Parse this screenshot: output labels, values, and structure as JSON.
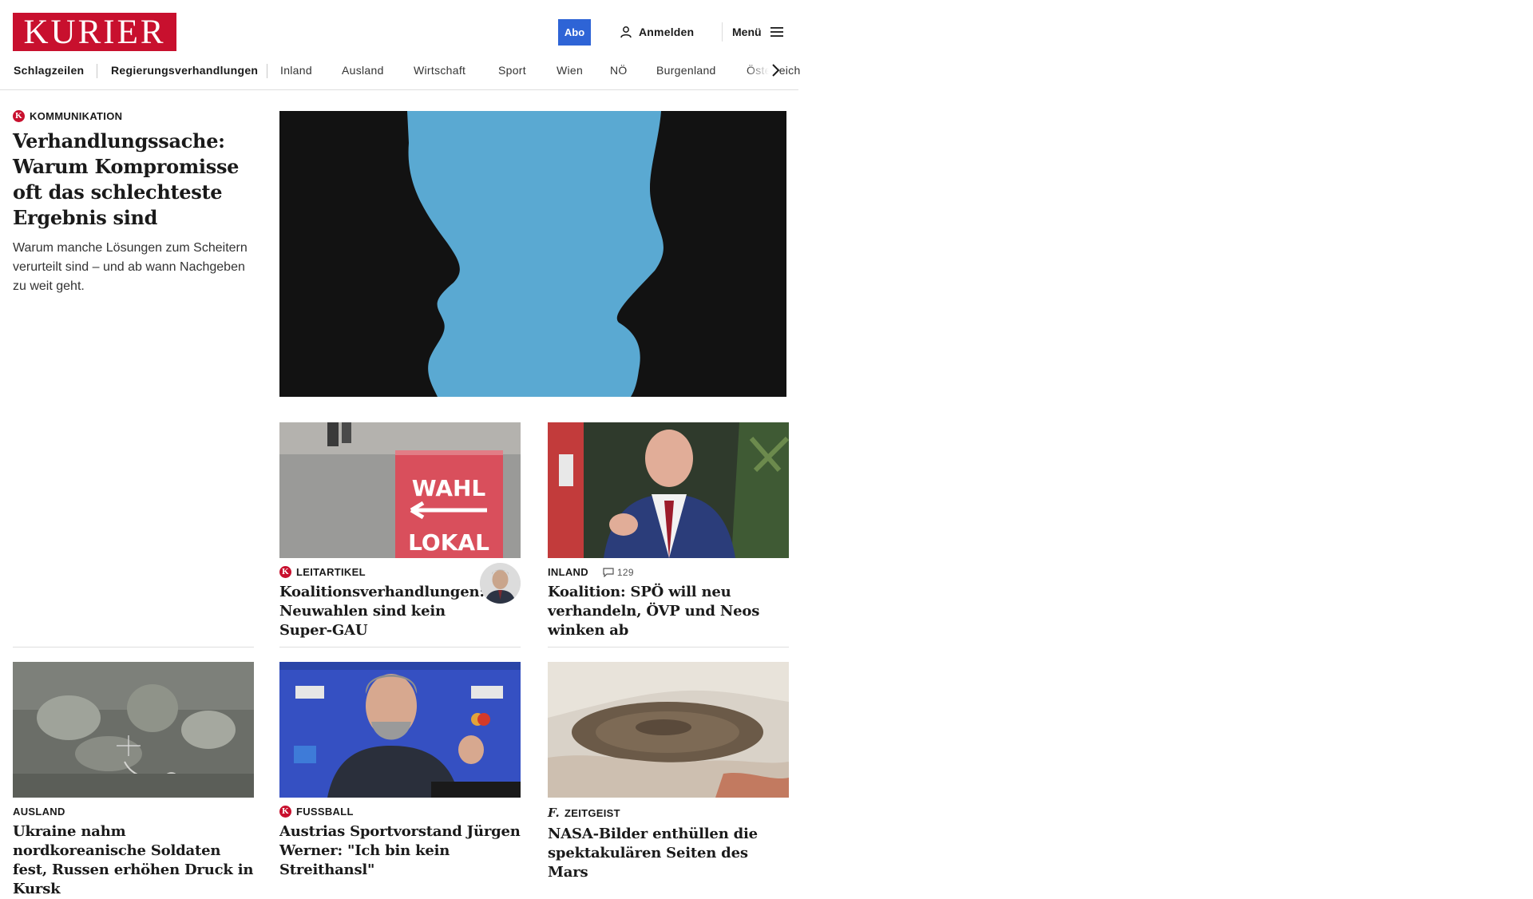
{
  "header": {
    "logo": "KURIER",
    "abo_label": "Abo",
    "login_label": "Anmelden",
    "menu_label": "Menü",
    "brand_color": "#c8102e",
    "accent_color": "#2e64d6"
  },
  "nav": {
    "items": [
      {
        "label": "Schlagzeilen"
      },
      {
        "label": "Regierungsverhandlungen"
      },
      {
        "label": "Inland"
      },
      {
        "label": "Ausland"
      },
      {
        "label": "Wirtschaft"
      },
      {
        "label": "Sport"
      },
      {
        "label": "Wien"
      },
      {
        "label": "NÖ"
      },
      {
        "label": "Burgenland"
      },
      {
        "label": "Österreich"
      }
    ],
    "scroll_icon": "chevron-right-icon"
  },
  "lead": {
    "kicker": "KOMMUNIKATION",
    "badge": "K",
    "title": "Verhandlungssache: Warum Kompromisse oft das schlechteste Ergebnis sind",
    "teaser": "Warum manche Lösungen zum Scheitern verurteilt sind – und ab wann Nachgeben zu weit geht."
  },
  "articles": [
    {
      "kicker": "LEITARTIKEL",
      "badge": "K",
      "title": "Koalitionsverhandlungen: Neuwahlen sind kein Super-GAU",
      "image_text": [
        "WAHL",
        "LOKAL"
      ]
    },
    {
      "kicker": "INLAND",
      "comments": "129",
      "title": "Koalition: SPÖ will neu verhandeln, ÖVP und Neos winken ab"
    },
    {
      "kicker": "AUSLAND",
      "title": "Ukraine nahm nordkoreanische Soldaten fest, Russen erhöhen Druck in Kursk"
    },
    {
      "kicker": "FUSSBALL",
      "badge": "K",
      "title": "Austrias Sportvorstand Jürgen Werner: \"Ich bin kein Streithansl\""
    },
    {
      "kicker": "ZEITGEIST",
      "badge": "f.",
      "title": "NASA-Bilder enthüllen die spektakulären Seiten des Mars"
    }
  ]
}
